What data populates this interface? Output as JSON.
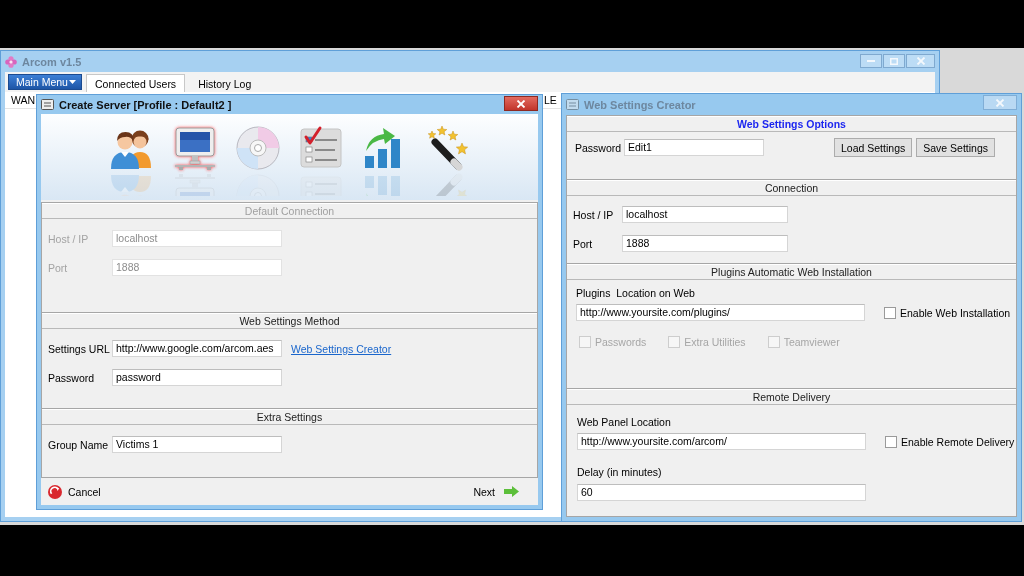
{
  "main_window": {
    "title": "Arcom v1.5",
    "active": false,
    "menu_button": "Main Menu",
    "tabs": [
      {
        "label": "Connected Users",
        "selected": true
      },
      {
        "label": "History Log",
        "selected": false
      }
    ],
    "table": {
      "columns": [
        "WAN",
        "LE"
      ]
    }
  },
  "create_server": {
    "title": "Create Server [Profile : Default2 ]",
    "active": true,
    "steps": [
      {
        "kind": "users",
        "selected": false
      },
      {
        "kind": "monitor",
        "selected": true
      },
      {
        "kind": "disc",
        "selected": false
      },
      {
        "kind": "checklist",
        "selected": false
      },
      {
        "kind": "chart",
        "selected": false
      },
      {
        "kind": "wand",
        "selected": false
      }
    ],
    "sections": [
      {
        "title": "Default Connection",
        "disabled": true,
        "fields": [
          {
            "label": "Host / IP",
            "value": "localhost"
          },
          {
            "label": "Port",
            "value": "1888"
          }
        ]
      },
      {
        "title": "Web Settings Method",
        "disabled": false,
        "fields": [
          {
            "label": "Settings URL",
            "value": "http://www.google.com/arcom.aes",
            "link": "Web Settings Creator"
          },
          {
            "label": "Password",
            "value": "password"
          }
        ]
      },
      {
        "title": "Extra Settings",
        "disabled": false,
        "fields": [
          {
            "label": "Group Name",
            "value": "Victims 1"
          }
        ]
      }
    ],
    "cancel": "Cancel",
    "next": "Next"
  },
  "web_settings_creator": {
    "title": "Web Settings Creator",
    "active": false,
    "options": {
      "title": "Web Settings Options",
      "password_label": "Password",
      "password": "Edit1",
      "buttons": [
        "Load Settings",
        "Save Settings"
      ]
    },
    "connection": {
      "title": "Connection",
      "fields": [
        {
          "label": "Host / IP",
          "value": "localhost"
        },
        {
          "label": "Port",
          "value": "1888"
        }
      ]
    },
    "plugins": {
      "title": "Plugins Automatic Web Installation",
      "location_label": "Plugins  Location on Web",
      "location": "http://www.yoursite.com/plugins/",
      "enable": {
        "label": "Enable Web Installation",
        "checked": false
      },
      "items": [
        {
          "label": "Passwords",
          "checked": false,
          "disabled": true
        },
        {
          "label": "Extra Utilities",
          "checked": false,
          "disabled": true
        },
        {
          "label": "Teamviewer",
          "checked": false,
          "disabled": true
        }
      ]
    },
    "remote_delivery": {
      "title": "Remote Delivery",
      "location_label": "Web Panel Location",
      "location": "http://www.yoursite.com/arcom/",
      "enable": {
        "label": "Enable Remote Delivery",
        "checked": false
      },
      "delay_label": "Delay (in minutes)",
      "delay": "60"
    }
  }
}
